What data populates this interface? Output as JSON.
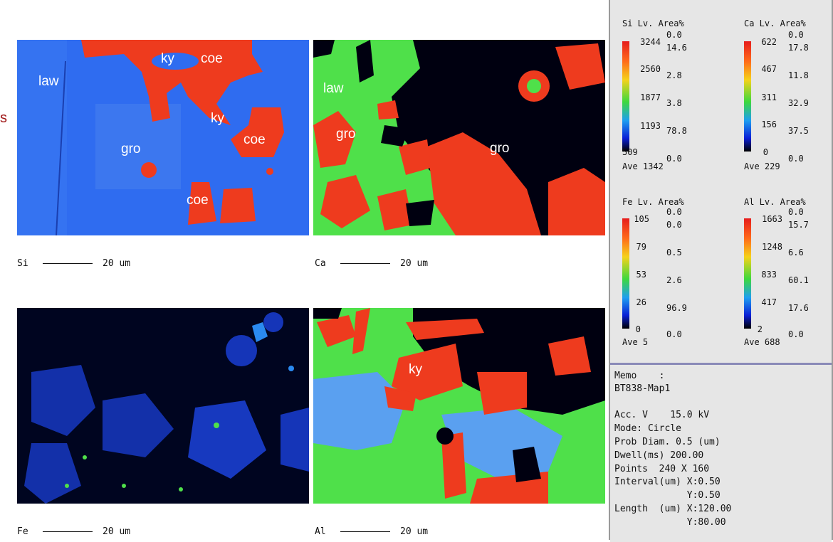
{
  "maps": {
    "si": {
      "element": "Si",
      "scale": "20 um",
      "labels": {
        "ky1": "ky",
        "coe1": "coe",
        "law": "law",
        "ky2": "ky",
        "gro": "gro",
        "coe2": "coe",
        "coe3": "coe"
      }
    },
    "ca": {
      "element": "Ca",
      "scale": "20 um",
      "labels": {
        "law": "law",
        "gro1": "gro",
        "gro2": "gro"
      }
    },
    "fe": {
      "element": "Fe",
      "scale": "20 um"
    },
    "al": {
      "element": "Al",
      "scale": "20 um",
      "labels": {
        "ky": "ky"
      }
    }
  },
  "legends": {
    "si": {
      "head": "Si Lv. Area%",
      "levels": [
        "3244",
        "2560",
        "1877",
        "1193",
        "509"
      ],
      "areas": [
        "0.0",
        "14.6",
        "2.8",
        "3.8",
        "78.8",
        "0.0"
      ],
      "ave": "Ave 1342"
    },
    "ca": {
      "head": "Ca Lv. Area%",
      "levels": [
        "622",
        "467",
        "311",
        "156",
        "0"
      ],
      "areas": [
        "0.0",
        "17.8",
        "11.8",
        "32.9",
        "37.5",
        "0.0"
      ],
      "ave": "Ave 229"
    },
    "fe": {
      "head": "Fe Lv. Area%",
      "levels": [
        "105",
        "79",
        "53",
        "26",
        "0"
      ],
      "areas": [
        "0.0",
        "0.0",
        "0.5",
        "2.6",
        "96.9",
        "0.0"
      ],
      "ave": "Ave 5"
    },
    "al": {
      "head": "Al Lv. Area%",
      "levels": [
        "1663",
        "1248",
        "833",
        "417",
        "2"
      ],
      "areas": [
        "0.0",
        "15.7",
        "6.6",
        "60.1",
        "17.6",
        "0.0"
      ],
      "ave": "Ave 688"
    }
  },
  "memo": {
    "title": "Memo    :",
    "name": "BT838-Map1",
    "acc": "Acc. V    15.0 kV",
    "mode": "Mode: Circle",
    "prob": "Prob Diam. 0.5 (um)",
    "dwell": "Dwell(ms) 200.00",
    "points": "Points  240 X 160",
    "interval_x": "Interval(um) X:0.50",
    "interval_y": "             Y:0.50",
    "length_x": "Length  (um) X:120.00",
    "length_y": "             Y:80.00"
  },
  "margin_mark": "s",
  "colors": {
    "blue_bg": "#2f6cf0",
    "red": "#ee3b1e",
    "green": "#4fe04a",
    "black": "#000010",
    "lightblue": "#5aa0f0"
  }
}
